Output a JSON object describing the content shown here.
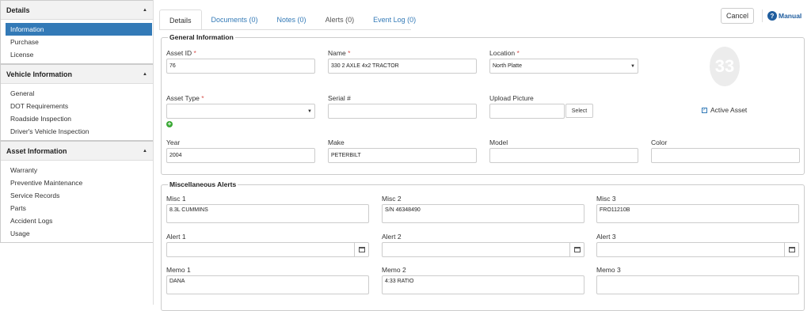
{
  "sidebar": {
    "sections": [
      {
        "title": "Details",
        "items": [
          "Information",
          "Purchase",
          "License"
        ]
      },
      {
        "title": "Vehicle Information",
        "items": [
          "General",
          "DOT Requirements",
          "Roadside Inspection",
          "Driver's Vehicle Inspection"
        ]
      },
      {
        "title": "Asset Information",
        "items": [
          "Warranty",
          "Preventive Maintenance",
          "Service Records",
          "Parts",
          "Accident Logs",
          "Usage"
        ]
      }
    ],
    "active_item": "Information"
  },
  "tabs": [
    "Details",
    "Documents (0)",
    "Notes (0)",
    "Alerts (0)",
    "Event Log (0)"
  ],
  "header": {
    "cancel_label": "Cancel",
    "manual_label": "Manual"
  },
  "general": {
    "legend": "General Information",
    "asset_id": {
      "label": "Asset ID",
      "value": "76"
    },
    "name": {
      "label": "Name",
      "value": "330 2 AXLE 4x2 TRACTOR"
    },
    "location": {
      "label": "Location",
      "value": "North Platte"
    },
    "asset_type": {
      "label": "Asset Type",
      "value": ""
    },
    "serial": {
      "label": "Serial #",
      "value": ""
    },
    "upload": {
      "label": "Upload Picture",
      "button": "Select"
    },
    "placeholder_number": "33",
    "active_asset": {
      "label": "Active Asset",
      "checked": true
    },
    "year": {
      "label": "Year",
      "value": "2004"
    },
    "make": {
      "label": "Make",
      "value": "PETERBILT"
    },
    "model": {
      "label": "Model",
      "value": ""
    },
    "color": {
      "label": "Color",
      "value": ""
    }
  },
  "misc": {
    "legend": "Miscellaneous Alerts",
    "misc1": {
      "label": "Misc 1",
      "value": "8.3L CUMMINS"
    },
    "misc2": {
      "label": "Misc 2",
      "value": "S/N 46348490"
    },
    "misc3": {
      "label": "Misc 3",
      "value": "FRO11210B"
    },
    "alert1": {
      "label": "Alert 1",
      "value": ""
    },
    "alert2": {
      "label": "Alert 2",
      "value": ""
    },
    "alert3": {
      "label": "Alert 3",
      "value": ""
    },
    "memo1": {
      "label": "Memo 1",
      "value": "DANA"
    },
    "memo2": {
      "label": "Memo 2",
      "value": "4:33 RATIO"
    },
    "memo3": {
      "label": "Memo 3",
      "value": ""
    }
  },
  "colors": {
    "accent": "#337ab7",
    "required": "#d9534f",
    "add": "#3aa935"
  }
}
